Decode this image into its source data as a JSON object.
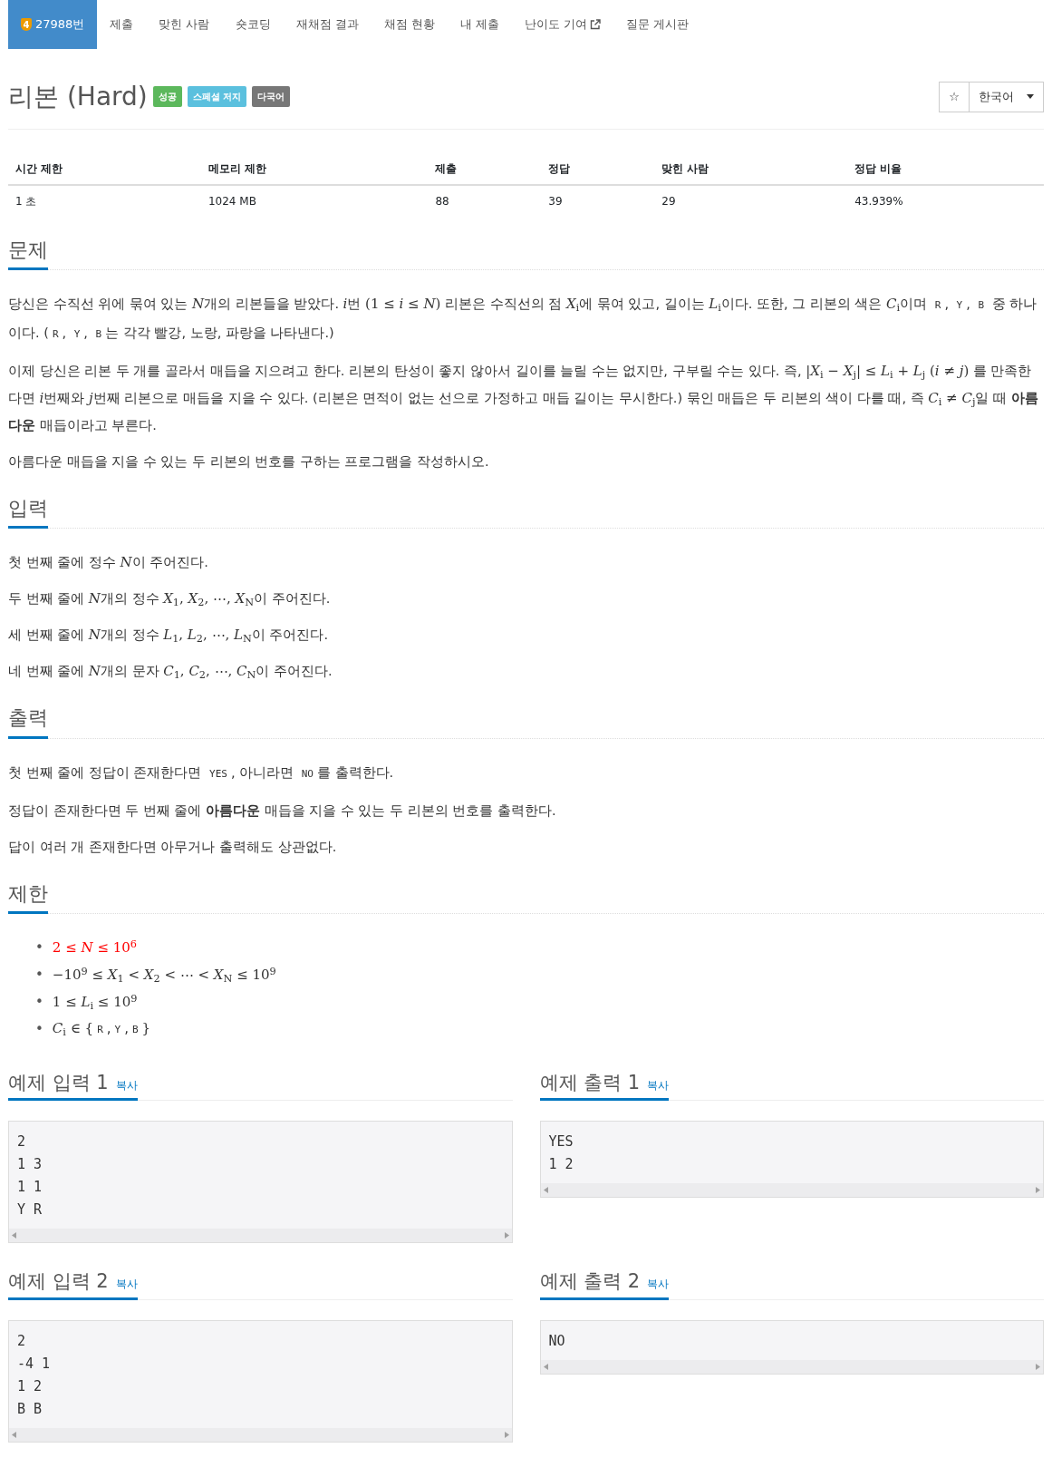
{
  "nav": {
    "items": [
      {
        "kind": "problem",
        "badge": "4",
        "label": "27988번",
        "selected": true
      },
      {
        "kind": "link",
        "label": "제출",
        "selected": false
      },
      {
        "kind": "link",
        "label": "맞힌 사람",
        "selected": false
      },
      {
        "kind": "link",
        "label": "숏코딩",
        "selected": false
      },
      {
        "kind": "link",
        "label": "재채점 결과",
        "selected": false
      },
      {
        "kind": "link",
        "label": "채점 현황",
        "selected": false
      },
      {
        "kind": "link",
        "label": "내 제출",
        "selected": false
      },
      {
        "kind": "external",
        "label": "난이도 기여",
        "selected": false
      },
      {
        "kind": "link",
        "label": "질문 게시판",
        "selected": false
      }
    ]
  },
  "title": "리본 (Hard)",
  "labels": [
    {
      "text": "성공",
      "color": "#5cb85c"
    },
    {
      "text": "스페셜 저지",
      "color": "#5bc0de"
    },
    {
      "text": "다국어",
      "color": "#777777"
    }
  ],
  "star_button": "☆",
  "language": "한국어",
  "stats": {
    "columns": [
      "시간 제한",
      "메모리 제한",
      "제출",
      "정답",
      "맞힌 사람",
      "정답 비율"
    ],
    "rows": [
      [
        "1 초",
        "1024 MB",
        "88",
        "39",
        "29",
        "43.939%"
      ]
    ]
  },
  "sections": [
    {
      "heading": "문제",
      "kind": "text",
      "paragraphs": [
        [
          {
            "kind": "text",
            "text": "당신은 수직선 위에 묶여 있는 "
          },
          {
            "kind": "math",
            "text": "*N*"
          },
          {
            "kind": "text",
            "text": "개의 리본들을 받았다. "
          },
          {
            "kind": "math",
            "text": "*i*"
          },
          {
            "kind": "text",
            "text": "번 "
          },
          {
            "kind": "math",
            "text": "(1 ≤ *i* ≤ *N*)"
          },
          {
            "kind": "text",
            "text": " 리본은 수직선의 점 "
          },
          {
            "kind": "math",
            "text": "*X*$_{i}$"
          },
          {
            "kind": "text",
            "text": "에 묶여 있고, 길이는 "
          },
          {
            "kind": "math",
            "text": "*L*$_{i}$"
          },
          {
            "kind": "text",
            "text": "이다. 또한, 그 리본의 색은 "
          },
          {
            "kind": "math",
            "text": "*C*$_{i}$"
          },
          {
            "kind": "text",
            "text": "이며 "
          },
          {
            "kind": "code",
            "text": "R"
          },
          {
            "kind": "text",
            "text": ", "
          },
          {
            "kind": "code",
            "text": "Y"
          },
          {
            "kind": "text",
            "text": ", "
          },
          {
            "kind": "code",
            "text": "B"
          },
          {
            "kind": "text",
            "text": " 중 하나이다. ("
          },
          {
            "kind": "code",
            "text": "R"
          },
          {
            "kind": "text",
            "text": ", "
          },
          {
            "kind": "code",
            "text": "Y"
          },
          {
            "kind": "text",
            "text": ", "
          },
          {
            "kind": "code",
            "text": "B"
          },
          {
            "kind": "text",
            "text": "는 각각 빨강, 노랑, 파랑을 나타낸다.)"
          }
        ],
        [
          {
            "kind": "text",
            "text": "이제 당신은 리본 두 개를 골라서 매듭을 지으려고 한다. 리본의 탄성이 좋지 않아서 길이를 늘릴 수는 없지만, 구부릴 수는 있다. 즉, "
          },
          {
            "kind": "math",
            "text": "|*X*$_{i}$ − *X*$_{j}$| ≤ *L*$_{i}$ + *L*$_{j}$ (*i* ≠ *j*)"
          },
          {
            "kind": "text",
            "text": " 를 만족한다면 "
          },
          {
            "kind": "math",
            "text": "*i*"
          },
          {
            "kind": "text",
            "text": "번째와 "
          },
          {
            "kind": "math",
            "text": "*j*"
          },
          {
            "kind": "text",
            "text": "번째 리본으로 매듭을 지을 수 있다. (리본은 면적이 없는 선으로 가정하고 매듭 길이는 무시한다.) 묶인 매듭은 두 리본의 색이 다를 때, 즉 "
          },
          {
            "kind": "math",
            "text": "*C*$_{i}$ ≠ *C*$_{j}$"
          },
          {
            "kind": "text",
            "text": "일 때 **아름다운** 매듭이라고 부른다."
          }
        ],
        [
          {
            "kind": "text",
            "text": "아름다운 매듭을 지을 수 있는 두 리본의 번호를 구하는 프로그램을 작성하시오."
          }
        ]
      ]
    },
    {
      "heading": "입력",
      "kind": "text",
      "paragraphs": [
        [
          {
            "kind": "text",
            "text": "첫 번째 줄에 정수 "
          },
          {
            "kind": "math",
            "text": "*N*"
          },
          {
            "kind": "text",
            "text": "이 주어진다."
          }
        ],
        [
          {
            "kind": "text",
            "text": "두 번째 줄에 "
          },
          {
            "kind": "math",
            "text": "*N*"
          },
          {
            "kind": "text",
            "text": "개의 정수 "
          },
          {
            "kind": "math",
            "text": "*X*$_{1}$, *X*$_{2}$, ⋯, *X*$_{N}$"
          },
          {
            "kind": "text",
            "text": "이 주어진다."
          }
        ],
        [
          {
            "kind": "text",
            "text": "세 번째 줄에 "
          },
          {
            "kind": "math",
            "text": "*N*"
          },
          {
            "kind": "text",
            "text": "개의 정수 "
          },
          {
            "kind": "math",
            "text": "*L*$_{1}$, *L*$_{2}$, ⋯, *L*$_{N}$"
          },
          {
            "kind": "text",
            "text": "이 주어진다."
          }
        ],
        [
          {
            "kind": "text",
            "text": "네 번째 줄에 "
          },
          {
            "kind": "math",
            "text": "*N*"
          },
          {
            "kind": "text",
            "text": "개의 문자 "
          },
          {
            "kind": "math",
            "text": "*C*$_{1}$, *C*$_{2}$, ⋯, *C*$_{N}$"
          },
          {
            "kind": "text",
            "text": "이 주어진다."
          }
        ]
      ]
    },
    {
      "heading": "출력",
      "kind": "text",
      "paragraphs": [
        [
          {
            "kind": "text",
            "text": "첫 번째 줄에 정답이 존재한다면 "
          },
          {
            "kind": "code",
            "text": "YES"
          },
          {
            "kind": "text",
            "text": ", 아니라면 "
          },
          {
            "kind": "code",
            "text": "NO"
          },
          {
            "kind": "text",
            "text": "를 출력한다."
          }
        ],
        [
          {
            "kind": "text",
            "text": "정답이 존재한다면 두 번째 줄에 **아름다운** 매듭을 지을 수 있는 두 리본의 번호를 출력한다."
          }
        ],
        [
          {
            "kind": "text",
            "text": "답이 여러 개 존재한다면 아무거나 출력해도 상관없다."
          }
        ]
      ]
    },
    {
      "heading": "제한",
      "kind": "list",
      "items": [
        {
          "marker": "•",
          "content": [
            {
              "kind": "math",
              "text": "2 ≤ *N* ≤ 10$^{6}$",
              "color": "#ff0000"
            }
          ]
        },
        {
          "marker": "•",
          "content": [
            {
              "kind": "math",
              "text": "−10$^{9}$ ≤ *X*$_{1}$ < *X*$_{2}$ < ⋯ < *X*$_{N}$ ≤ 10$^{9}$"
            }
          ]
        },
        {
          "marker": "•",
          "content": [
            {
              "kind": "math",
              "text": "1 ≤ *L*$_{i}$ ≤ 10$^{9}$"
            }
          ]
        },
        {
          "marker": "•",
          "content": [
            {
              "kind": "math",
              "text": "*C*$_{i}$ ∈ {"
            },
            {
              "kind": "code",
              "text": "R"
            },
            {
              "kind": "text",
              "text": ", "
            },
            {
              "kind": "code",
              "text": "Y"
            },
            {
              "kind": "text",
              "text": ", "
            },
            {
              "kind": "code",
              "text": "B"
            },
            {
              "kind": "math",
              "text": "}"
            }
          ]
        }
      ]
    }
  ],
  "examples": [
    {
      "heading": "예제 입력 1",
      "copy": "복사",
      "content": "2\n1 3\n1 1\nY R"
    },
    {
      "heading": "예제 출력 1",
      "copy": "복사",
      "content": "YES\n1 2"
    },
    {
      "heading": "예제 입력 2",
      "copy": "복사",
      "content": "2\n-4 1\n1 2\nB B"
    },
    {
      "heading": "예제 출력 2",
      "copy": "복사",
      "content": "NO"
    }
  ]
}
